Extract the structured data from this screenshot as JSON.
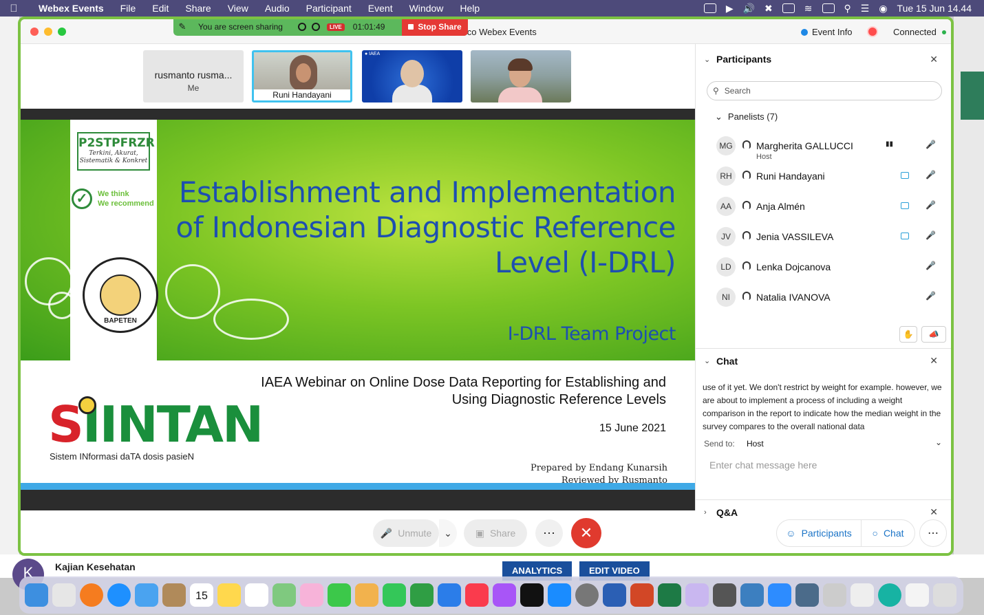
{
  "menubar": {
    "app": "Webex Events",
    "items": [
      "File",
      "Edit",
      "Share",
      "View",
      "Audio",
      "Participant",
      "Event",
      "Window",
      "Help"
    ],
    "clock": "Tue 15 Jun  14.44"
  },
  "window": {
    "title": "Cisco Webex Events",
    "event_info": "Event Info",
    "connection": "Connected"
  },
  "sharing_banner": {
    "text": "You are screen sharing",
    "live": "LIVE",
    "timer": "01:01:49",
    "stop": "Stop Share"
  },
  "videos": {
    "me_name": "rusmanto rusma...",
    "me_label": "Me",
    "active_name": "Runi Handayani"
  },
  "slide": {
    "ribbon_title": "P2STPFRZR",
    "ribbon_sub": "Terkini, Akurat, Sistematik & Konkret",
    "think": "We think",
    "recommend": "We recommend",
    "title": "Establishment and Implementation of Indonesian Diagnostic Reference Level (I-DRL)",
    "team": "I-DRL Team Project",
    "logo_text": "SIINTAN",
    "logo_sub": "Sistem INformasi daTA dosis pasieN",
    "webinar": "IAEA Webinar on Online Dose Data Reporting for Establishing and Using Diagnostic Reference Levels",
    "date": "15 June 2021",
    "prepared": "Prepared by Endang Kunarsih",
    "reviewed": "Reviewed by Rusmanto",
    "seal_text": "BAPETEN"
  },
  "controls": {
    "unmute": "Unmute",
    "share": "Share",
    "participants": "Participants",
    "chat": "Chat"
  },
  "panel": {
    "participants_title": "Participants",
    "search_placeholder": "Search",
    "panelists_label": "Panelists (7)",
    "panelists": [
      {
        "initials": "MG",
        "name": "Margherita GALLUCCI",
        "role": "Host"
      },
      {
        "initials": "RH",
        "name": "Runi Handayani",
        "role": ""
      },
      {
        "initials": "AA",
        "name": "Anja Almén",
        "role": ""
      },
      {
        "initials": "JV",
        "name": "Jenia VASSILEVA",
        "role": ""
      },
      {
        "initials": "LD",
        "name": "Lenka Dojcanova",
        "role": ""
      },
      {
        "initials": "NI",
        "name": "Natalia IVANOVA",
        "role": ""
      }
    ],
    "chat_title": "Chat",
    "chat_message": "use of it yet. We don't restrict by weight for example. however, we are about to implement a process of including a weight comparison in the report to indicate how the median weight in the survey compares to the overall national data",
    "send_to_label": "Send to:",
    "send_to_value": "Host",
    "chat_placeholder": "Enter chat message here",
    "qa_title": "Q&A"
  },
  "background": {
    "channel": "Kajian Kesehatan",
    "avatar_letter": "K",
    "analytics": "ANALYTICS",
    "edit_video": "EDIT VIDEO"
  },
  "dock": {
    "calendar_day": "15"
  },
  "colors": {
    "window_border": "#7cc243",
    "accent_blue": "#1b74c7",
    "end_red": "#e03a2e",
    "slide_title_blue": "#1d4fb0"
  }
}
